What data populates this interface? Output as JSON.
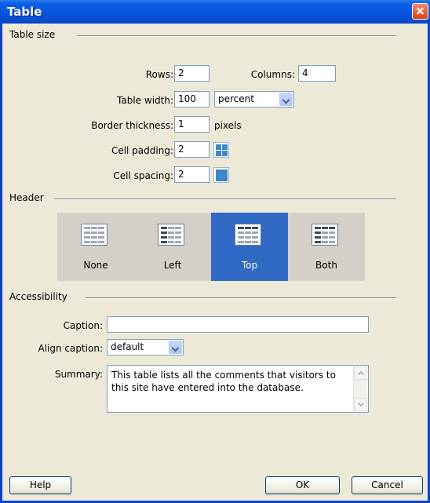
{
  "window": {
    "title": "Table"
  },
  "table_size": {
    "section_label": "Table size",
    "rows_label": "Rows:",
    "rows_value": "2",
    "columns_label": "Columns:",
    "columns_value": "4",
    "width_label": "Table width:",
    "width_value": "100",
    "width_unit": "percent",
    "border_label": "Border thickness:",
    "border_value": "1",
    "border_unit": "pixels",
    "padding_label": "Cell padding:",
    "padding_value": "2",
    "spacing_label": "Cell spacing:",
    "spacing_value": "2"
  },
  "header": {
    "section_label": "Header",
    "options": [
      {
        "label": "None",
        "selected": false
      },
      {
        "label": "Left",
        "selected": false
      },
      {
        "label": "Top",
        "selected": true
      },
      {
        "label": "Both",
        "selected": false
      }
    ]
  },
  "accessibility": {
    "section_label": "Accessibility",
    "caption_label": "Caption:",
    "caption_value": "",
    "align_label": "Align caption:",
    "align_value": "default",
    "summary_label": "Summary:",
    "summary_value": "This table lists all the comments that visitors to this site have entered into the database."
  },
  "buttons": {
    "help": "Help",
    "ok": "OK",
    "cancel": "Cancel"
  },
  "colors": {
    "title_bar": "#0554dc",
    "selected_header": "#316ac5",
    "close_button": "#d9431c"
  }
}
